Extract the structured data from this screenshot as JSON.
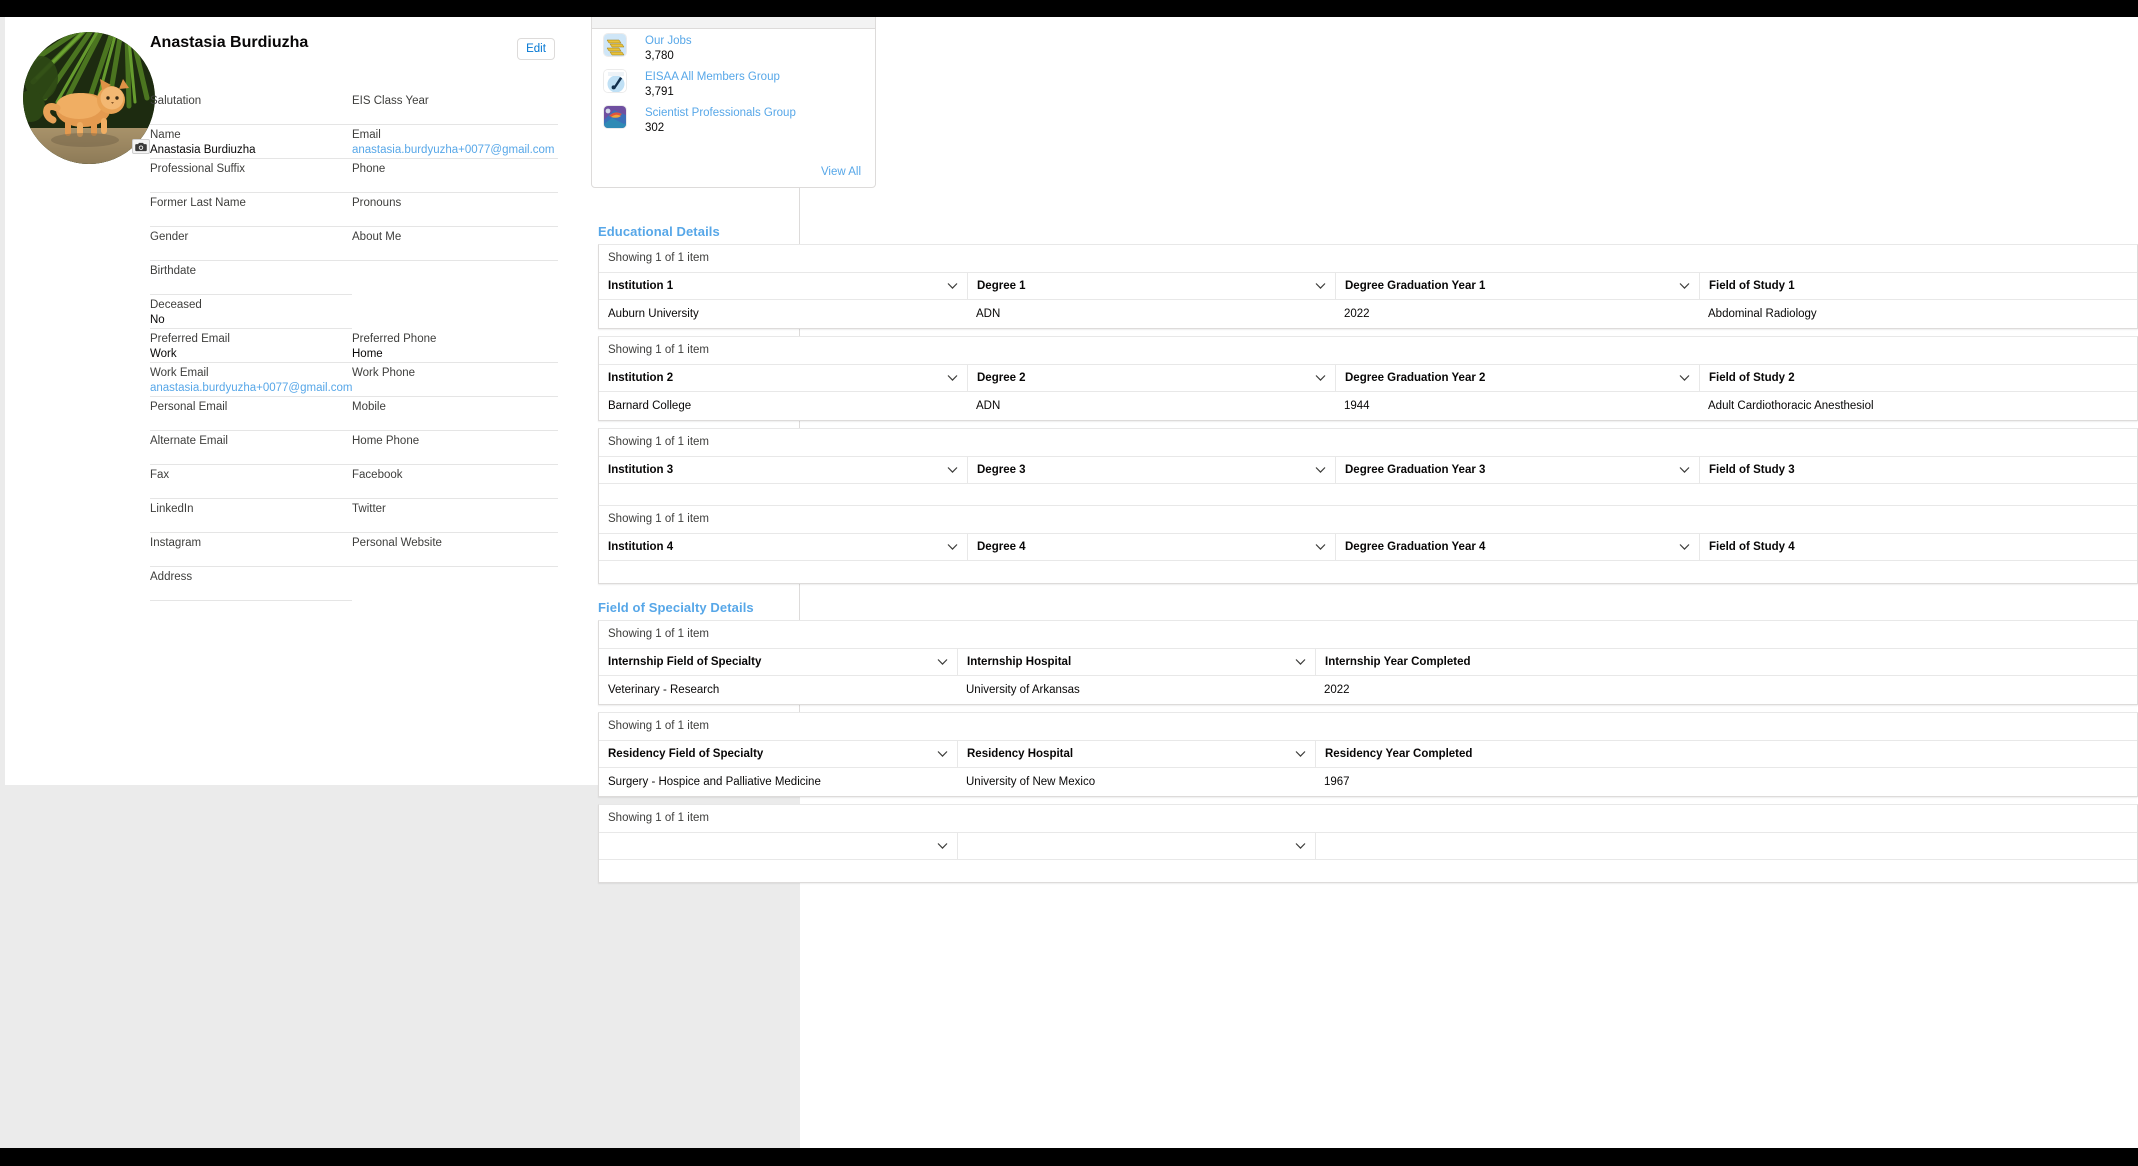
{
  "profile": {
    "name": "Anastasia Burdiuzha",
    "edit_label": "Edit",
    "avatar_alt": "orange-kitten-photo",
    "camera_icon": "camera-icon",
    "fields": [
      {
        "left_label": "Salutation",
        "left_value": "",
        "right_label": "EIS Class Year",
        "right_value": ""
      },
      {
        "left_label": "Name",
        "left_value": "Anastasia Burdiuzha",
        "right_label": "Email",
        "right_value": "anastasia.burdyuzha+0077@gmail.com",
        "right_link": true
      },
      {
        "left_label": "Professional Suffix",
        "left_value": "",
        "right_label": "Phone",
        "right_value": ""
      },
      {
        "left_label": "Former Last Name",
        "left_value": "",
        "right_label": "Pronouns",
        "right_value": ""
      },
      {
        "left_label": "Gender",
        "left_value": "",
        "right_label": "About Me",
        "right_value": ""
      },
      {
        "left_label": "Birthdate",
        "left_value": "",
        "right_label": "",
        "right_value": ""
      },
      {
        "left_label": "Deceased",
        "left_value": "No",
        "right_label": "",
        "right_value": ""
      },
      {
        "left_label": "Preferred Email",
        "left_value": "Work",
        "right_label": "Preferred Phone",
        "right_value": "Home"
      },
      {
        "left_label": "Work Email",
        "left_value": "anastasia.burdyuzha+0077@gmail.com",
        "left_link": true,
        "right_label": "Work Phone",
        "right_value": ""
      },
      {
        "left_label": "Personal Email",
        "left_value": "",
        "right_label": "Mobile",
        "right_value": ""
      },
      {
        "left_label": "Alternate Email",
        "left_value": "",
        "right_label": "Home Phone",
        "right_value": ""
      },
      {
        "left_label": "Fax",
        "left_value": "",
        "right_label": "Facebook",
        "right_value": ""
      },
      {
        "left_label": "LinkedIn",
        "left_value": "",
        "right_label": "Twitter",
        "right_value": ""
      },
      {
        "left_label": "Instagram",
        "left_value": "",
        "right_label": "Personal Website",
        "right_value": ""
      },
      {
        "left_label": "Address",
        "left_value": "",
        "right_label": "",
        "right_value": ""
      }
    ]
  },
  "groups_card": {
    "view_all_label": "View All",
    "items": [
      {
        "name": "Our Jobs",
        "count": "3,780",
        "icon": "gold-bars-icon"
      },
      {
        "name": "EISAA All Members Group",
        "count": "3,791",
        "icon": "megaphone-icon"
      },
      {
        "name": "Scientist Professionals Group",
        "count": "302",
        "icon": "abstract-art-icon"
      }
    ]
  },
  "educational_details": {
    "title": "Educational Details",
    "blocks": [
      {
        "showing": "Showing 1 of 1 item",
        "headers": [
          "Institution 1",
          "Degree 1",
          "Degree Graduation Year 1",
          "Field of Study 1"
        ],
        "row": [
          "Auburn University",
          "ADN",
          "2022",
          "Abdominal Radiology"
        ],
        "has_row": true
      },
      {
        "showing": "Showing 1 of 1 item",
        "headers": [
          "Institution 2",
          "Degree 2",
          "Degree Graduation Year 2",
          "Field of Study 2"
        ],
        "row": [
          "Barnard College",
          "ADN",
          "1944",
          "Adult Cardiothoracic Anesthesiol"
        ],
        "has_row": true
      },
      {
        "showing": "Showing 1 of 1 item",
        "headers": [
          "Institution 3",
          "Degree 3",
          "Degree Graduation Year 3",
          "Field of Study 3"
        ],
        "row": [
          "",
          "",
          "",
          ""
        ],
        "has_row": false
      },
      {
        "showing": "Showing 1 of 1 item",
        "headers": [
          "Institution 4",
          "Degree 4",
          "Degree Graduation Year 4",
          "Field of Study 4"
        ],
        "row": [
          "",
          "",
          "",
          ""
        ],
        "has_row": false
      }
    ]
  },
  "specialty_details": {
    "title": "Field of Specialty Details",
    "blocks": [
      {
        "showing": "Showing 1 of 1 item",
        "headers": [
          "Internship Field of Specialty",
          "Internship Hospital",
          "Internship Year Completed"
        ],
        "row": [
          "Veterinary - Research",
          "University of Arkansas",
          "2022"
        ],
        "has_row": true
      },
      {
        "showing": "Showing 1 of 1 item",
        "headers": [
          "Residency Field of Specialty",
          "Residency Hospital",
          "Residency Year Completed"
        ],
        "row": [
          "Surgery - Hospice and Palliative Medicine",
          "University of New Mexico",
          "1967"
        ],
        "has_row": true
      },
      {
        "showing": "Showing 1 of 1 item",
        "headers": [
          "",
          "",
          ""
        ],
        "row": [
          "",
          "",
          ""
        ],
        "has_row": false
      }
    ]
  },
  "colors": {
    "link": "#57a7e8",
    "accent": "#0176d3",
    "page_bg": "#ebebeb",
    "border": "#dddbda"
  }
}
